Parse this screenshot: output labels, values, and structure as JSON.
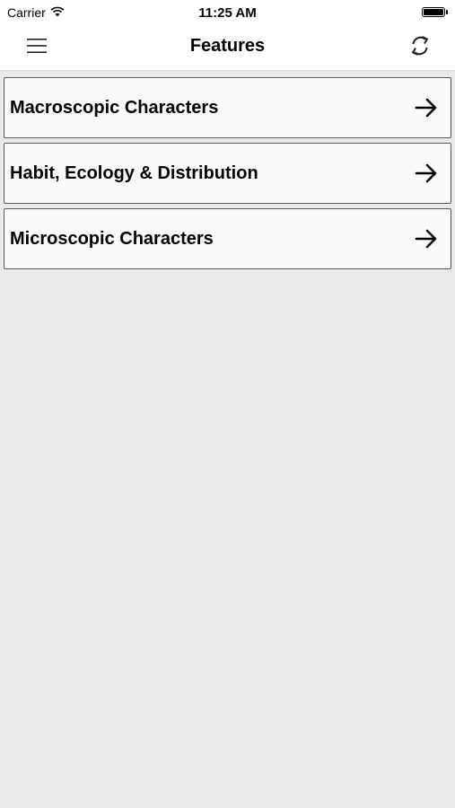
{
  "status_bar": {
    "carrier": "Carrier",
    "time": "11:25 AM",
    "wifi_icon": "wifi-icon",
    "battery_icon": "battery-icon"
  },
  "nav": {
    "title": "Features",
    "menu_icon": "hamburger-menu-icon",
    "refresh_icon": "refresh-icon"
  },
  "list": {
    "items": [
      {
        "label": "Macroscopic Characters",
        "icon": "arrow-right-icon"
      },
      {
        "label": "Habit, Ecology & Distribution",
        "icon": "arrow-right-icon"
      },
      {
        "label": "Microscopic Characters",
        "icon": "arrow-right-icon"
      }
    ]
  },
  "colors": {
    "background": "#e9e9e9",
    "bar_background": "#ffffff",
    "item_background": "#fafafa",
    "item_border": "#5a5a5a"
  }
}
